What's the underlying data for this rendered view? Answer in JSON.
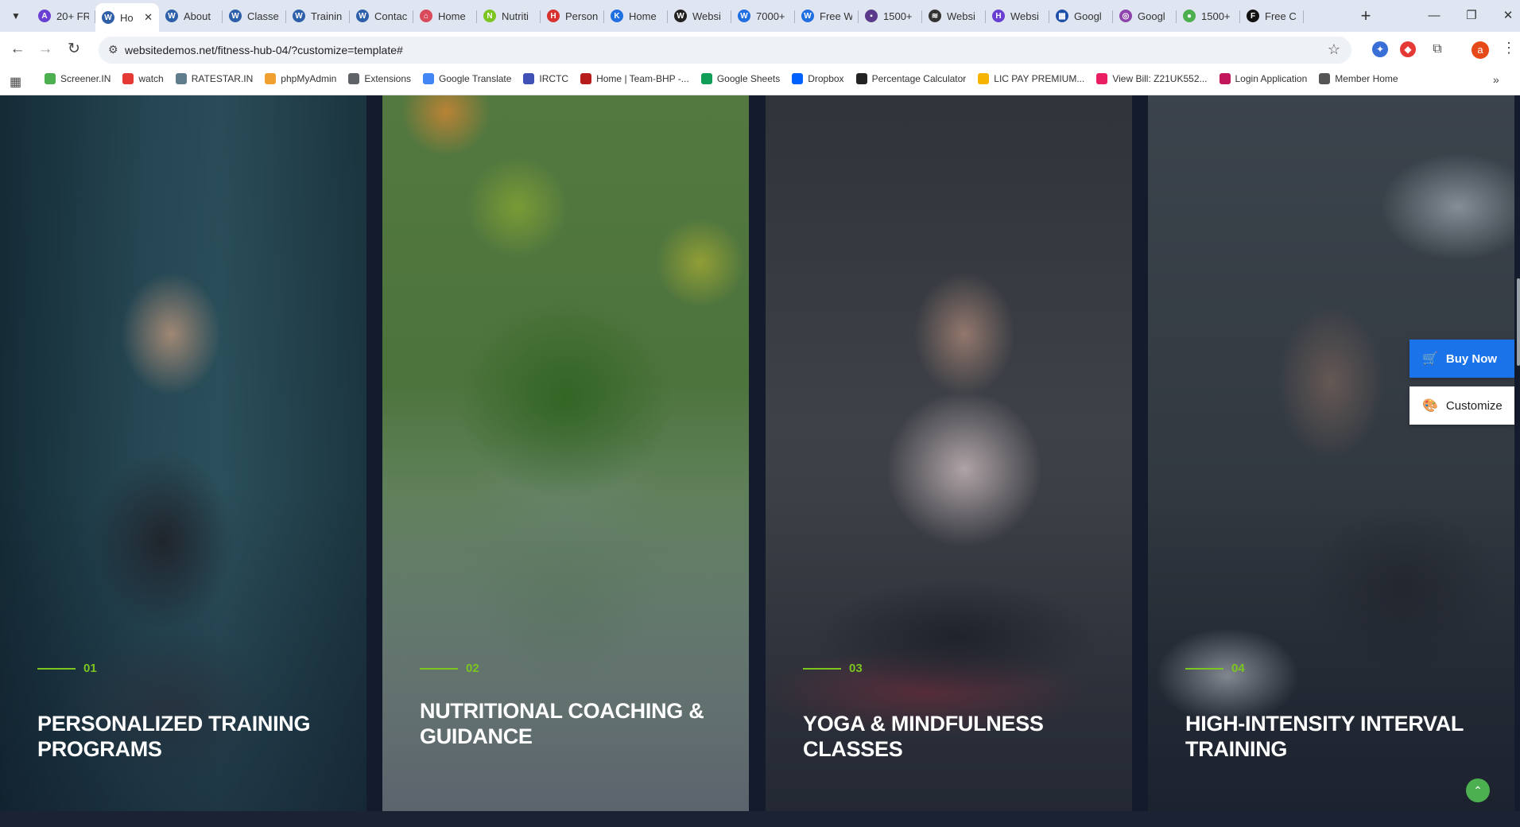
{
  "browser": {
    "tabs": [
      {
        "title": "20+ FR",
        "fav_color": "#6a3fd3",
        "fav_glyph": "A"
      },
      {
        "title": "Ho",
        "fav_color": "#2f5fa8",
        "fav_glyph": "W",
        "active": true
      },
      {
        "title": "About",
        "fav_color": "#2f5fa8",
        "fav_glyph": "W"
      },
      {
        "title": "Classe",
        "fav_color": "#2f5fa8",
        "fav_glyph": "W"
      },
      {
        "title": "Trainin",
        "fav_color": "#2f5fa8",
        "fav_glyph": "W"
      },
      {
        "title": "Contac",
        "fav_color": "#2f5fa8",
        "fav_glyph": "W"
      },
      {
        "title": "Home",
        "fav_color": "#d94a5b",
        "fav_glyph": "⌂"
      },
      {
        "title": "Nutriti",
        "fav_color": "#7cc520",
        "fav_glyph": "N"
      },
      {
        "title": "Person",
        "fav_color": "#d93030",
        "fav_glyph": "H"
      },
      {
        "title": "Home",
        "fav_color": "#1f6fe0",
        "fav_glyph": "K"
      },
      {
        "title": "Websi",
        "fav_color": "#222222",
        "fav_glyph": "W"
      },
      {
        "title": "7000+",
        "fav_color": "#1f6fe0",
        "fav_glyph": "W"
      },
      {
        "title": "Free W",
        "fav_color": "#1f6fe0",
        "fav_glyph": "W"
      },
      {
        "title": "1500+",
        "fav_color": "#5b3a8c",
        "fav_glyph": "▪"
      },
      {
        "title": "Websi",
        "fav_color": "#333333",
        "fav_glyph": "≋"
      },
      {
        "title": "Websi",
        "fav_color": "#6a3fd3",
        "fav_glyph": "H"
      },
      {
        "title": "Googl",
        "fav_color": "#1f4fa8",
        "fav_glyph": "▦"
      },
      {
        "title": "Googl",
        "fav_color": "#8e44ad",
        "fav_glyph": "◎"
      },
      {
        "title": "1500+",
        "fav_color": "#4caf50",
        "fav_glyph": "●"
      },
      {
        "title": "Free C",
        "fav_color": "#111111",
        "fav_glyph": "F"
      }
    ],
    "tab_close_glyph": "✕",
    "new_tab_glyph": "+",
    "window_controls": {
      "minimize": "—",
      "restore": "❐",
      "close": "✕"
    },
    "url": "websitedemos.net/fitness-hub-04/?customize=template#",
    "profile_initial": "a",
    "bookmarks": [
      {
        "label": "Screener.IN",
        "color": "#4caf50"
      },
      {
        "label": "watch",
        "color": "#e53935"
      },
      {
        "label": "RATESTAR.IN",
        "color": "#607d8b"
      },
      {
        "label": "phpMyAdmin",
        "color": "#f0a030"
      },
      {
        "label": "Extensions",
        "color": "#5f6368"
      },
      {
        "label": "Google Translate",
        "color": "#4285f4"
      },
      {
        "label": "IRCTC",
        "color": "#3f51b5"
      },
      {
        "label": "Home | Team-BHP -...",
        "color": "#b71c1c"
      },
      {
        "label": "Google Sheets",
        "color": "#0f9d58"
      },
      {
        "label": "Dropbox",
        "color": "#0061fe"
      },
      {
        "label": "Percentage Calculator",
        "color": "#222222"
      },
      {
        "label": "LIC PAY PREMIUM...",
        "color": "#f4b400"
      },
      {
        "label": "View Bill: Z21UK552...",
        "color": "#e91e63"
      },
      {
        "label": "Login Application",
        "color": "#c2185b"
      },
      {
        "label": "Member Home",
        "color": "#555555"
      }
    ]
  },
  "page": {
    "cards": [
      {
        "num": "01",
        "title": "Personalized Training Programs"
      },
      {
        "num": "02",
        "title": "Nutritional Coaching & Guidance"
      },
      {
        "num": "03",
        "title": "Yoga & Mindfulness Classes"
      },
      {
        "num": "04",
        "title": "High-Intensity Interval Training"
      }
    ],
    "buy_now_label": "Buy Now",
    "customize_label": "Customize",
    "accent": "#7cc520"
  }
}
